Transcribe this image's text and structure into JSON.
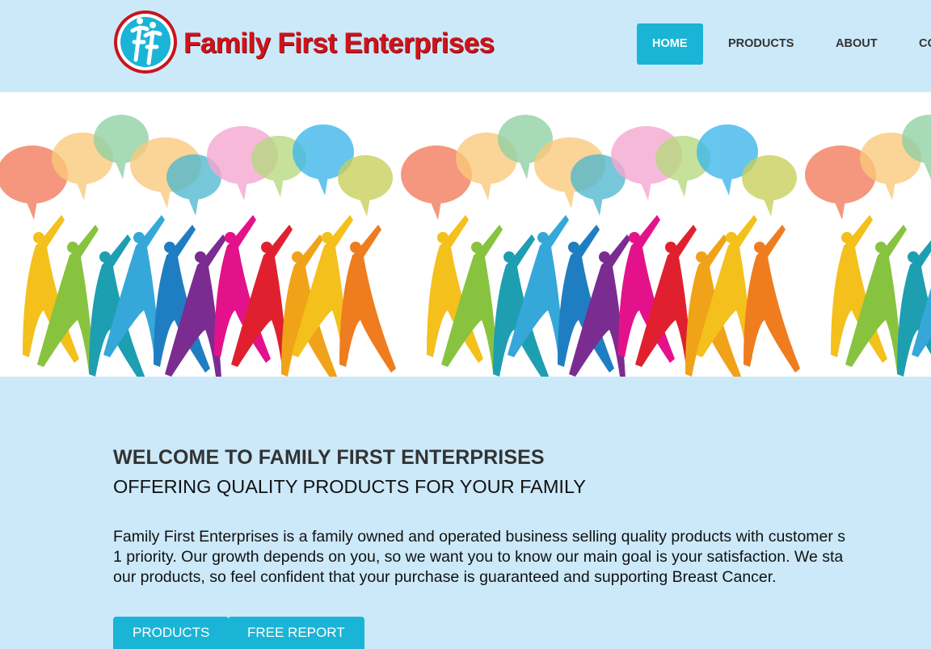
{
  "header": {
    "brand": "Family First Enterprises",
    "logo_initials": "FF"
  },
  "nav": {
    "items": [
      {
        "label": "HOME",
        "active": true
      },
      {
        "label": "PRODUCTS",
        "active": false
      },
      {
        "label": "ABOUT",
        "active": false
      },
      {
        "label": "CO",
        "active": false
      }
    ]
  },
  "hero": {
    "image": "colorful-people-with-speech-bubbles"
  },
  "main": {
    "welcome": "WELCOME TO FAMILY FIRST ENTERPRISES",
    "subtitle": "OFFERING QUALITY PRODUCTS FOR YOUR FAMILY",
    "paragraph_lines": [
      "Family First Enterprises is a family owned and operated business selling quality products with customer s",
      "1 priority. Our growth depends on you, so we want you to know our main goal is your satisfaction. We sta",
      "our products, so feel confident that your purchase is guaranteed and supporting Breast Cancer."
    ],
    "buttons": {
      "products": "PRODUCTS",
      "free_report": "FREE REPORT"
    }
  },
  "colors": {
    "background": "#cce9fa",
    "accent": "#1ab4d6",
    "brand_red": "#d1121a"
  }
}
